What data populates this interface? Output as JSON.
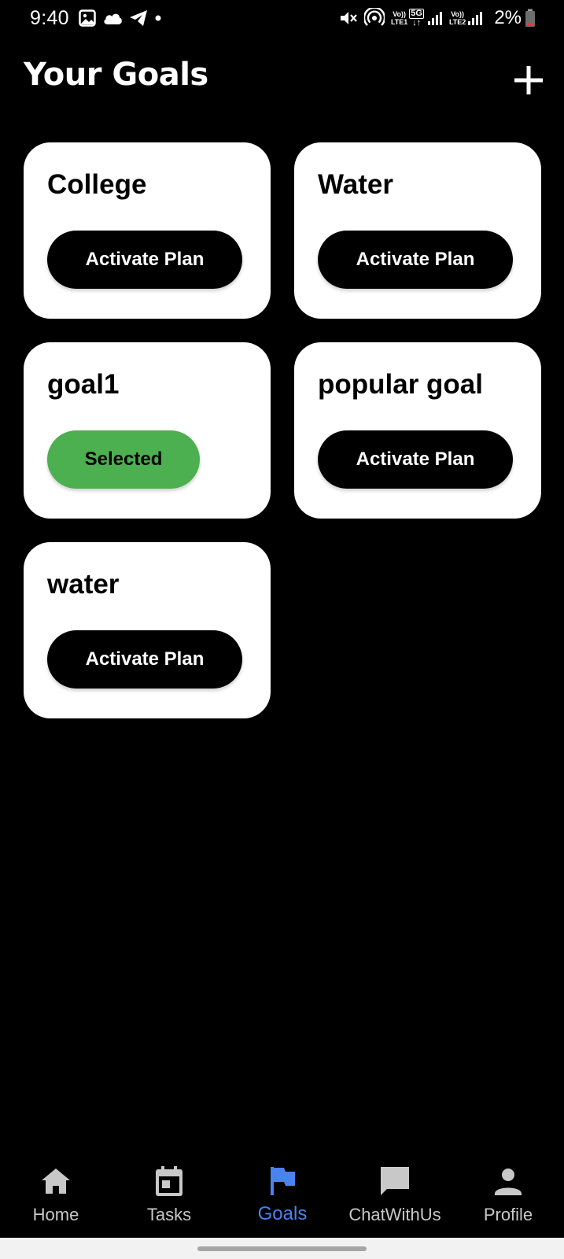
{
  "status_bar": {
    "time": "9:40",
    "battery": "2%",
    "net1_top": "Vo))",
    "net1_bottom": "LTE1",
    "net_5g": "5G",
    "net2_top": "Vo))",
    "net2_bottom": "LTE2",
    "icons": [
      "gallery-icon",
      "cloud-icon",
      "telegram-icon",
      "dot-icon",
      "mute-icon",
      "hotspot-icon",
      "signal-icon",
      "battery-icon"
    ]
  },
  "header": {
    "title": "Your Goals",
    "add_icon": "plus-icon"
  },
  "goals": [
    {
      "title": "College",
      "action": "Activate Plan",
      "state": "inactive"
    },
    {
      "title": "Water",
      "action": "Activate Plan",
      "state": "inactive"
    },
    {
      "title": "goal1",
      "action": "Selected",
      "state": "selected"
    },
    {
      "title": "popular goal",
      "action": "Activate Plan",
      "state": "inactive"
    },
    {
      "title": "water",
      "action": "Activate Plan",
      "state": "inactive"
    }
  ],
  "bottom_nav": {
    "items": [
      {
        "label": "Home",
        "icon": "home-icon",
        "active": false
      },
      {
        "label": "Tasks",
        "icon": "calendar-icon",
        "active": false
      },
      {
        "label": "Goals",
        "icon": "flag-icon",
        "active": true
      },
      {
        "label": "ChatWithUs",
        "icon": "chat-icon",
        "active": false
      },
      {
        "label": "Profile",
        "icon": "person-icon",
        "active": false
      }
    ]
  },
  "colors": {
    "background": "#000000",
    "card": "#ffffff",
    "activate_button": "#000000",
    "selected_button": "#4caf50",
    "nav_active": "#4a82f0",
    "nav_inactive": "#c8c8c8"
  }
}
